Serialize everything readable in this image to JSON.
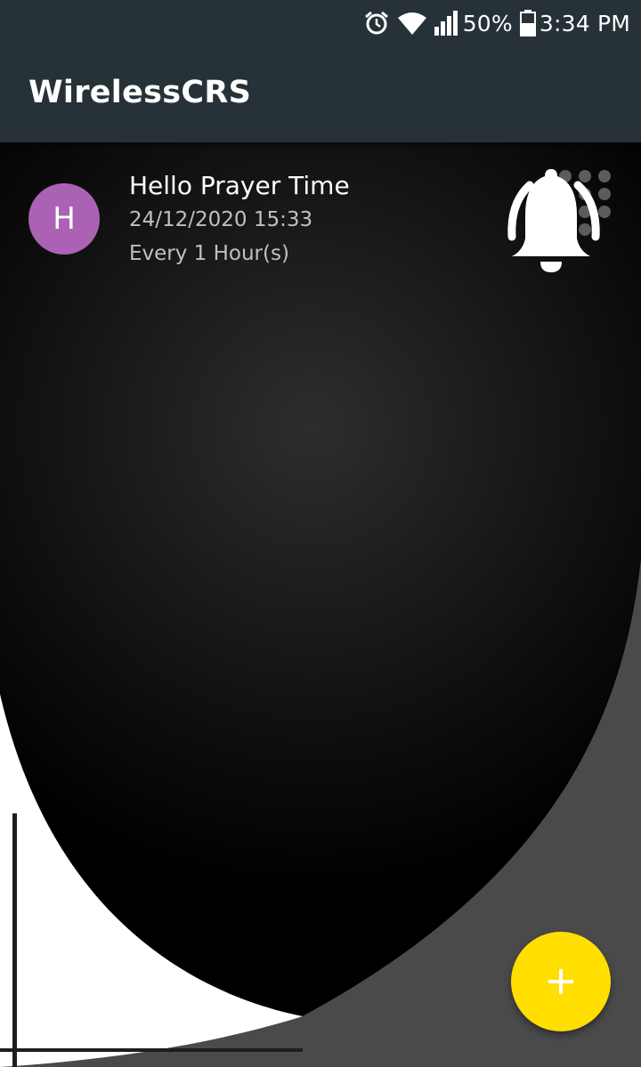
{
  "status_bar": {
    "battery_percent": "50%",
    "time": "3:34 PM",
    "icons": [
      "alarm-icon",
      "wifi-icon",
      "cellular-signal-icon",
      "battery-icon"
    ]
  },
  "app_bar": {
    "title": "WirelessCRS",
    "color": "#263238"
  },
  "reminders": [
    {
      "avatar_letter": "H",
      "avatar_color": "#ab62b4",
      "title": "Hello Prayer Time",
      "datetime": "24/12/2020 15:33",
      "repeat": "Every 1 Hour(s)",
      "status_icon": "bell-ringing-icon"
    }
  ],
  "fab": {
    "icon": "plus-icon",
    "color": "#ffde00"
  }
}
